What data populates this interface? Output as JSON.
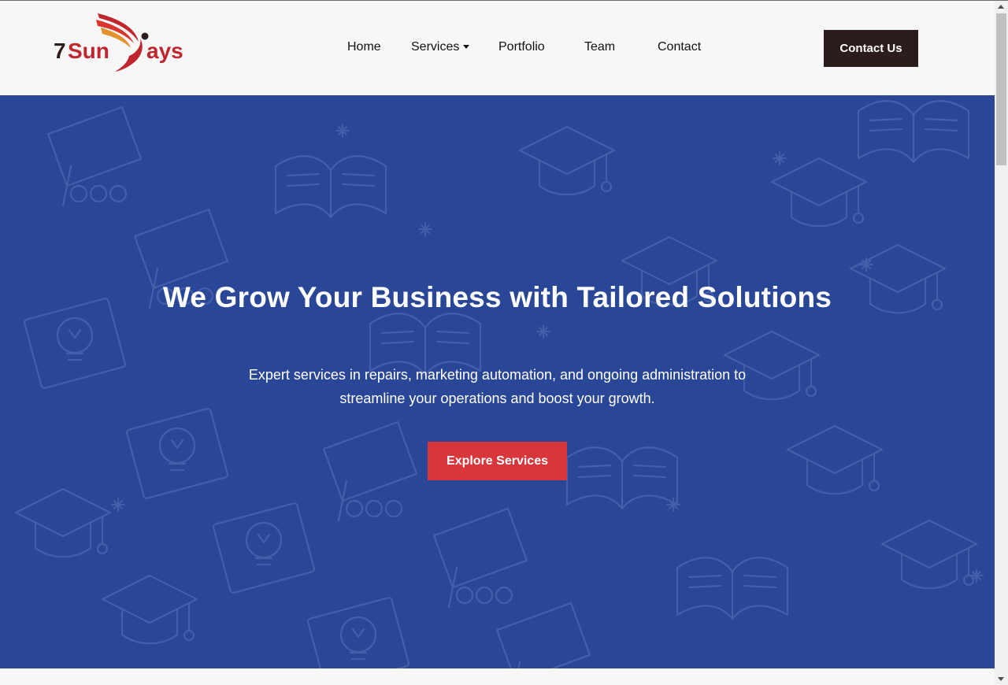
{
  "brand": {
    "logo_text_dark": "7",
    "logo_text_red": "Sun",
    "logo_text_tail": "ays",
    "colors": {
      "dark": "#2b1d1b",
      "red": "#c0262d",
      "orange": "#e2912b"
    }
  },
  "nav": {
    "items": [
      {
        "label": "Home",
        "has_dropdown": false
      },
      {
        "label": "Services",
        "has_dropdown": true,
        "icon": "caret-down-icon"
      },
      {
        "label": "Portfolio",
        "has_dropdown": false
      },
      {
        "label": "Team",
        "has_dropdown": false
      },
      {
        "label": "Contact",
        "has_dropdown": false
      }
    ],
    "cta_label": "Contact Us"
  },
  "hero": {
    "title": "We Grow Your Business with Tailored Solutions",
    "subtitle": "Expert services in repairs, marketing automation, and ongoing administration to streamline your operations and boost your growth.",
    "cta_label": "Explore Services",
    "background_color": "#2a4797",
    "cta_color": "#d8363a"
  }
}
